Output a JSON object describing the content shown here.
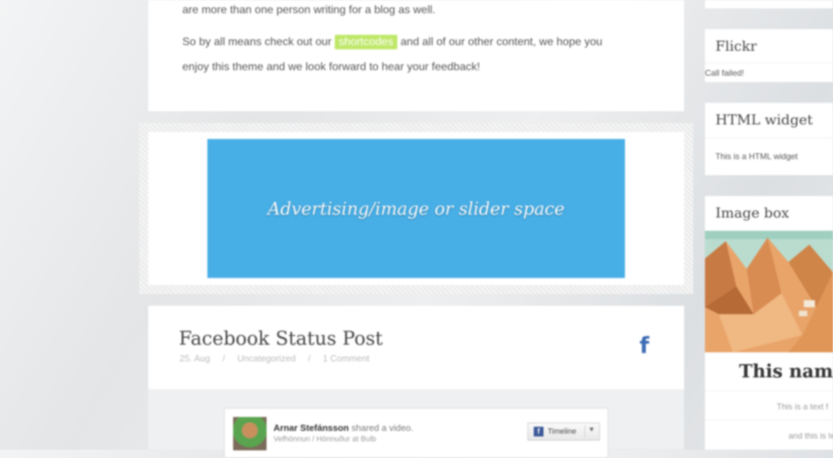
{
  "post_excerpt": {
    "line1": "are more than one person writing for a blog as well.",
    "line2_before": "So by all means check out our",
    "line2_highlight": "shortcodes",
    "line2_after": "and all of our other content, we hope you",
    "line3": "enjoy this theme and we look forward to hear your feedback!"
  },
  "ad": {
    "text": "Advertising/image or slider space",
    "color": "#47aee6"
  },
  "facebook_post": {
    "title": "Facebook Status Post",
    "date": "25. Aug",
    "sep1": "/",
    "category": "Uncategorized",
    "sep2": "/",
    "comments": "1 Comment",
    "icon": "facebook-icon",
    "embed": {
      "author": "Arnar Stefánsson",
      "action": "shared a video.",
      "subtitle": "Vefhönnun / Hönnuður at Bulb",
      "timeline_button": "Timeline"
    }
  },
  "sidebar": {
    "flickr": {
      "title": "Flickr",
      "status": "Call failed!"
    },
    "html_widget": {
      "title": "HTML widget",
      "text": "This is a HTML widget"
    },
    "image_box": {
      "title": "Image box",
      "caption": "This name",
      "text1": "This is a text f",
      "text2": "and this is te"
    }
  }
}
